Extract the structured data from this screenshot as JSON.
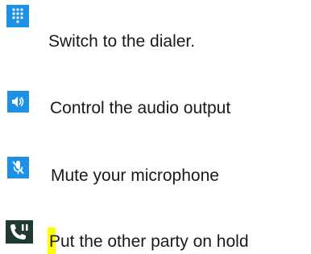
{
  "items": [
    {
      "icon": "dialpad-icon",
      "label": "Switch to the dialer."
    },
    {
      "icon": "speaker-icon",
      "label": "Control the audio output"
    },
    {
      "icon": "mic-muted-icon",
      "label": "Mute your microphone"
    },
    {
      "icon": "call-hold-icon",
      "label": "Put the other party on hold"
    }
  ],
  "colors": {
    "icon_blue": "#1e90e6",
    "icon_dark": "#1f3a33",
    "highlight": "#ffff00",
    "text": "#1a1a1a"
  }
}
